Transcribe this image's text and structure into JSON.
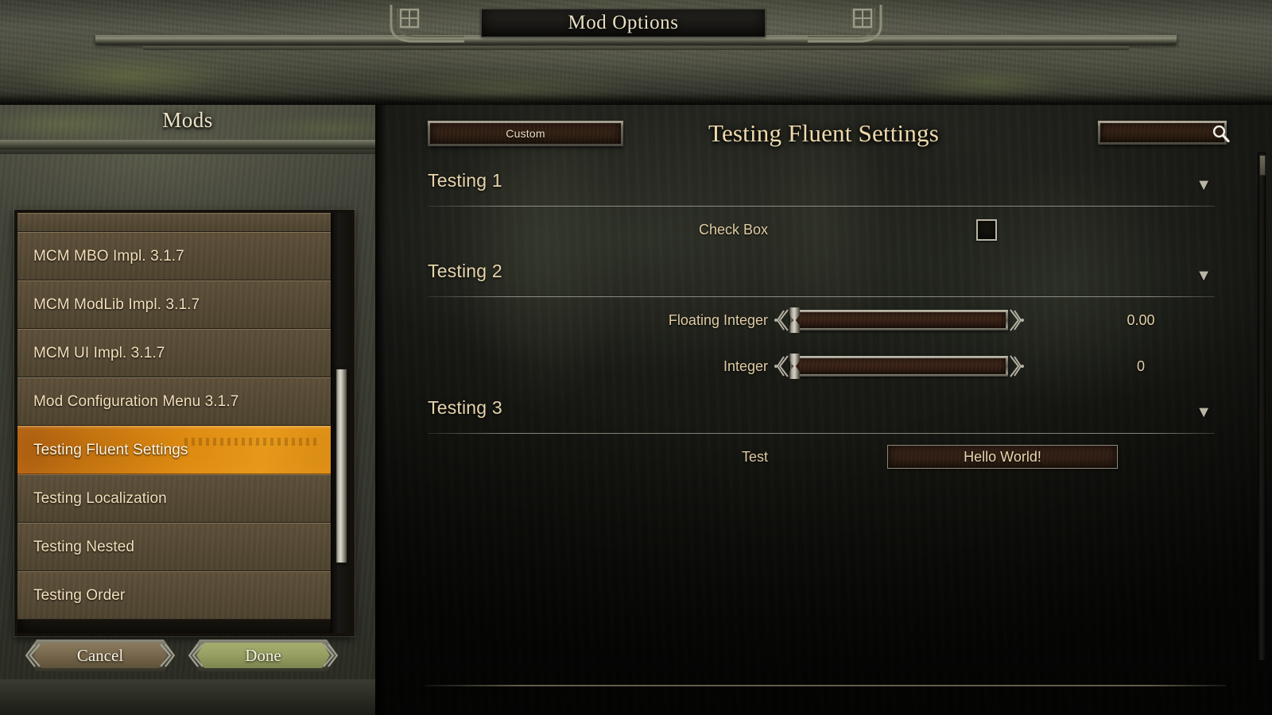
{
  "window": {
    "title": "Mod Options"
  },
  "sidebar": {
    "heading": "Mods",
    "items": [
      {
        "label": "",
        "partial": true,
        "selected": false
      },
      {
        "label": "MCM MBO Impl. 3.1.7",
        "selected": false
      },
      {
        "label": "MCM ModLib Impl. 3.1.7",
        "selected": false
      },
      {
        "label": "MCM UI Impl. 3.1.7",
        "selected": false
      },
      {
        "label": "Mod Configuration Menu 3.1.7",
        "selected": false
      },
      {
        "label": "Testing Fluent Settings",
        "selected": true
      },
      {
        "label": "Testing Localization",
        "selected": false
      },
      {
        "label": "Testing Nested",
        "selected": false
      },
      {
        "label": "Testing Order",
        "selected": false
      }
    ],
    "cancel_label": "Cancel",
    "done_label": "Done"
  },
  "content": {
    "page_title": "Testing Fluent Settings",
    "custom_button_label": "Custom",
    "search_value": "",
    "search_placeholder": "",
    "groups": [
      {
        "name": "Testing 1",
        "collapse_glyph": "▼",
        "rows": [
          {
            "type": "checkbox",
            "label": "Check Box",
            "checked": false,
            "value": ""
          }
        ]
      },
      {
        "name": "Testing 2",
        "collapse_glyph": "▼",
        "rows": [
          {
            "type": "slider",
            "label": "Floating Integer",
            "value": "0.00",
            "fill_percent": 0
          },
          {
            "type": "slider",
            "label": "Integer",
            "value": "0",
            "fill_percent": 0
          }
        ]
      },
      {
        "name": "Testing 3",
        "collapse_glyph": "▼",
        "rows": [
          {
            "type": "textfield",
            "label": "Test",
            "value": "Hello World!"
          }
        ]
      }
    ]
  },
  "colors": {
    "accent_selected": "#dd8b12",
    "text_gold": "#e6d4ab",
    "text_cream": "#f3dfb9",
    "done_green": "#98a062",
    "panel_stone": "#3a3b31"
  }
}
